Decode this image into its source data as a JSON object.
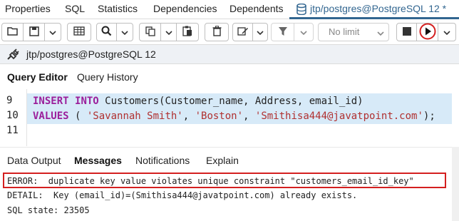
{
  "top_tabs": {
    "items": [
      "Properties",
      "SQL",
      "Statistics",
      "Dependencies",
      "Dependents"
    ],
    "active": "jtp/postgres@PostgreSQL 12 *"
  },
  "toolbar": {
    "limit_value": "No limit",
    "icons": [
      "folder-open",
      "save",
      "chevron-down",
      "table-grid",
      "search",
      "chevron-down",
      "copy",
      "chevron-down",
      "paste",
      "trash",
      "edit",
      "chevron-down",
      "filter",
      "chevron-down",
      "stop",
      "execute",
      "chevron-down"
    ]
  },
  "connection": {
    "label": "jtp/postgres@PostgreSQL 12"
  },
  "query_tabs": {
    "editor": "Query Editor",
    "history": "Query History"
  },
  "editor": {
    "lines": [
      {
        "num": "9",
        "tokens": [
          {
            "t": "INSERT",
            "k": "kw"
          },
          {
            "t": " ",
            "k": "ident"
          },
          {
            "t": "INTO",
            "k": "kw"
          },
          {
            "t": " Customers(Customer_name, Address, email_id)",
            "k": "ident"
          }
        ]
      },
      {
        "num": "10",
        "tokens": [
          {
            "t": "VALUES",
            "k": "kw"
          },
          {
            "t": " ( ",
            "k": "ident"
          },
          {
            "t": "'Savannah Smith'",
            "k": "str"
          },
          {
            "t": ", ",
            "k": "ident"
          },
          {
            "t": "'Boston'",
            "k": "str"
          },
          {
            "t": ", ",
            "k": "ident"
          },
          {
            "t": "'Smithisa444@javatpoint.com'",
            "k": "str"
          },
          {
            "t": ");",
            "k": "ident"
          }
        ]
      },
      {
        "num": "11",
        "tokens": []
      }
    ]
  },
  "result_tabs": {
    "data_output": "Data Output",
    "messages": "Messages",
    "notifications": "Notifications",
    "explain": "Explain"
  },
  "messages": {
    "error": "ERROR:  duplicate key value violates unique constraint \"customers_email_id_key\"",
    "detail": "DETAIL:  Key (email_id)=(Smithisa444@javatpoint.com) already exists.",
    "sql_state": "SQL state: 23505"
  },
  "colors": {
    "accent": "#326690",
    "error_border": "#d41f1f",
    "selection": "#d7eaf8",
    "keyword": "#9b1f9b",
    "string": "#b03030"
  }
}
